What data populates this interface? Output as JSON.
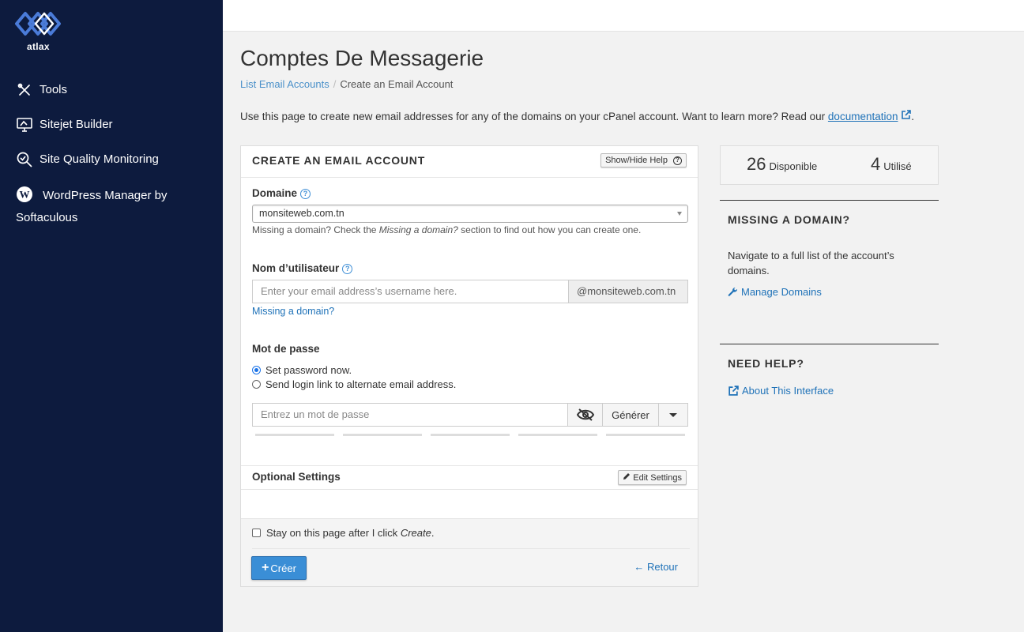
{
  "sidebar": {
    "logo_text": "atlax",
    "items": [
      {
        "label": "Tools"
      },
      {
        "label": "Sitejet Builder"
      },
      {
        "label": "Site Quality Monitoring"
      },
      {
        "label": "WordPress Manager by Softaculous"
      }
    ]
  },
  "page": {
    "title": "Comptes De Messagerie",
    "breadcrumb": {
      "parent": "List Email Accounts",
      "separator": "/",
      "current": "Create an Email Account"
    },
    "intro": "Use this page to create new email addresses for any of the domains on your cPanel account. Want to learn more? Read our",
    "intro_link": "documentation",
    "intro_end": "."
  },
  "form": {
    "title": "CREATE AN EMAIL ACCOUNT",
    "help_button": "Show/Hide Help",
    "domain_label": "Domaine",
    "domain_value": "monsiteweb.com.tn",
    "domain_hint_before": "Missing a domain? Check the",
    "domain_hint_em": "Missing a domain?",
    "domain_hint_after": "section to find out how you can create one.",
    "username_label": "Nom d’utilisateur",
    "username_placeholder": "Enter your email address’s username here.",
    "username_suffix": "@monsiteweb.com.tn",
    "missing_domain_link": "Missing a domain?",
    "password_label": "Mot de passe",
    "radio_set_now": "Set password now.",
    "radio_send_link": "Send login link to alternate email address.",
    "password_placeholder": "Entrez un mot de passe",
    "generate_button": "Générer",
    "optional_title": "Optional Settings",
    "edit_settings_button": "Edit Settings",
    "stay_label_before": "Stay on this page after I click",
    "stay_label_em": "Create",
    "stay_label_after": ".",
    "create_button": "Créer",
    "back_button": "Retour"
  },
  "stats": {
    "available_count": "26",
    "available_label": "Disponible",
    "used_count": "4",
    "used_label": "Utilisé"
  },
  "missing_domain": {
    "title": "MISSING A DOMAIN?",
    "text": "Navigate to a full list of the account’s domains.",
    "link": "Manage Domains"
  },
  "need_help": {
    "title": "NEED HELP?",
    "link": "About This Interface"
  },
  "colors": {
    "sidebar_bg": "#0d1b3e",
    "link": "#1f72b8",
    "primary_button": "#3a8ed6",
    "logo_accent": "#4a7bd8"
  }
}
